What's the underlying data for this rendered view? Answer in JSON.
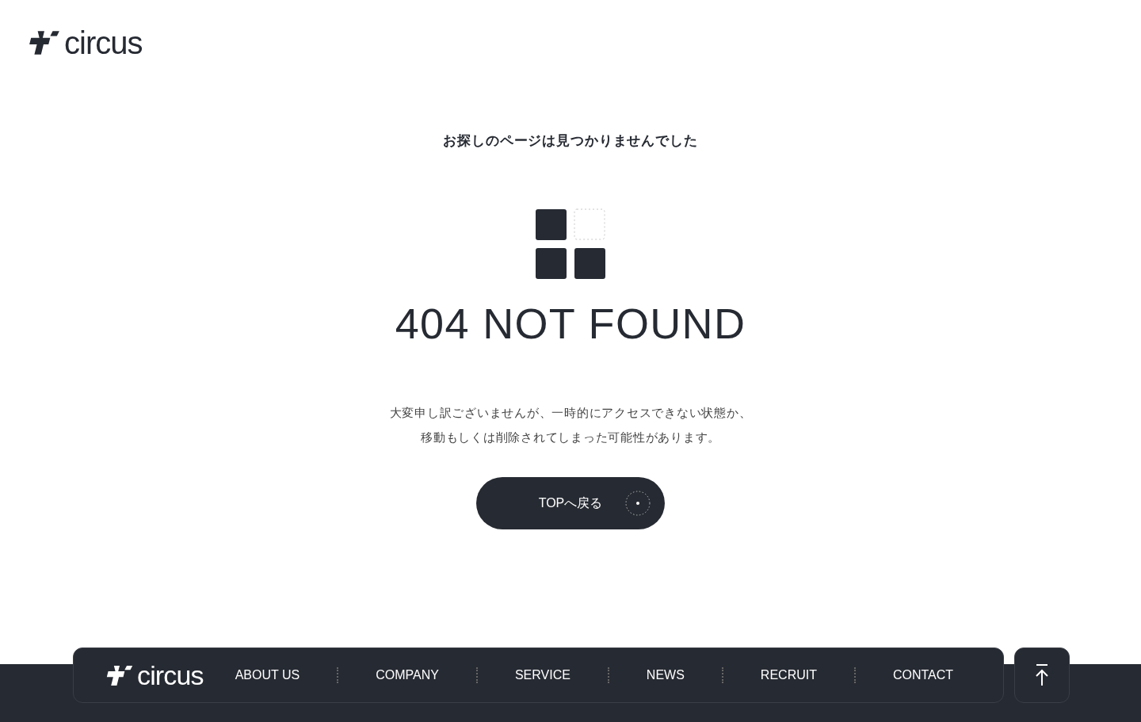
{
  "header": {
    "logo_text": "circus"
  },
  "main": {
    "heading": "お探しのページは見つかりませんでした",
    "title": "404 NOT FOUND",
    "message": [
      "大変申し訳ございませんが、一時的にアクセスできない状態か、",
      "移動もしくは削除されてしまった可能性があります。"
    ],
    "button": "TOPへ戻る"
  },
  "footer": {
    "logo_text": "circus",
    "nav": [
      "ABOUT US",
      "COMPANY",
      "SERVICE",
      "NEWS",
      "RECRUIT",
      "CONTACT"
    ]
  }
}
